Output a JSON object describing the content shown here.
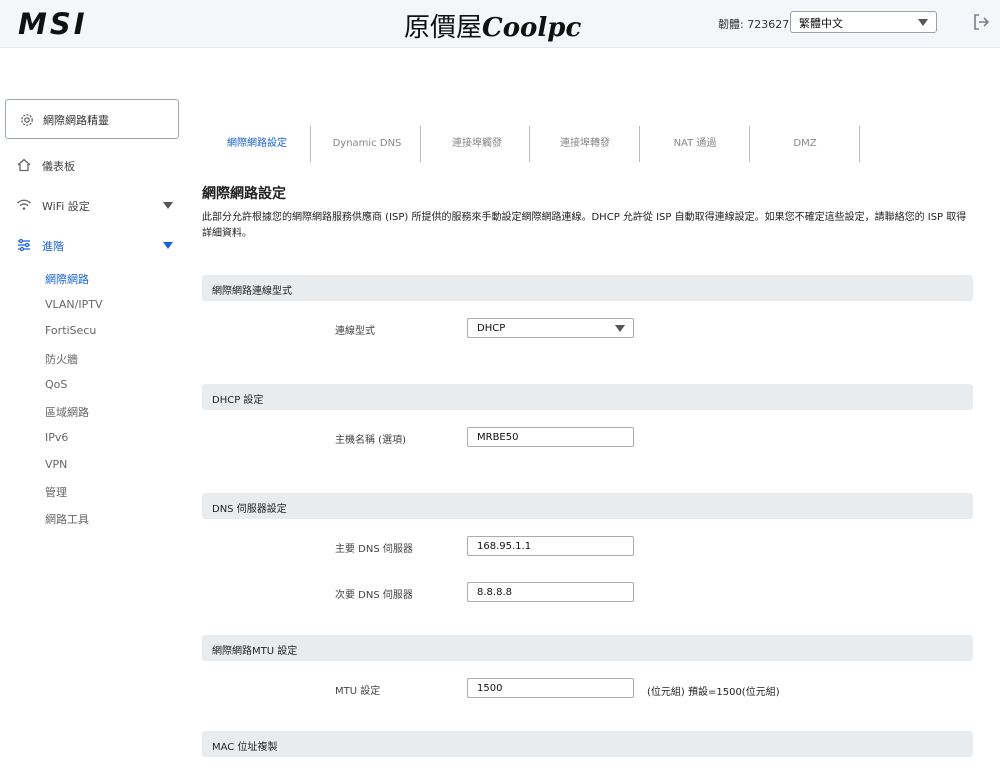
{
  "header": {
    "logo": "MSI",
    "brand_cjk": "原價屋",
    "brand_latin": "Coolpc",
    "firmware": "韌體: 723627",
    "language": "繁體中文"
  },
  "sidebar": {
    "wizard": "網際網路精靈",
    "items": [
      {
        "label": "儀表板",
        "icon": "dashboard-icon"
      },
      {
        "label": "WiFi 設定",
        "icon": "wifi-icon"
      },
      {
        "label": "進階",
        "icon": "sliders-icon"
      }
    ],
    "sub_items": [
      "網際網路",
      "VLAN/IPTV",
      "FortiSecu",
      "防火牆",
      "QoS",
      "區域網路",
      "IPv6",
      "VPN",
      "管理",
      "網路工具"
    ]
  },
  "tabs": [
    "網際網路設定",
    "Dynamic DNS",
    "連接埠觸發",
    "連接埠轉發",
    "NAT 通過",
    "DMZ"
  ],
  "main": {
    "title": "網際網路設定",
    "description": "此部分允許根據您的網際網路服務供應商 (ISP) 所提供的服務來手動設定網際網路連線。DHCP 允許從 ISP 自動取得連線設定。如果您不確定這些設定，請聯絡您的 ISP 取得詳細資料。",
    "sections": {
      "connection_type": {
        "header": "網際網路連線型式",
        "label": "連線型式",
        "value": "DHCP"
      },
      "dhcp": {
        "header": "DHCP 設定",
        "hostname_label": "主機名稱 (選項)",
        "hostname_value": "MRBE50"
      },
      "dns": {
        "header": "DNS 伺服器設定",
        "primary_label": "主要 DNS 伺服器",
        "primary_value": "168.95.1.1",
        "secondary_label": "次要 DNS 伺服器",
        "secondary_value": "8.8.8.8"
      },
      "mtu": {
        "header": "網際網路MTU 設定",
        "label": "MTU 設定",
        "value": "1500",
        "note": "(位元組)  預設=1500(位元組)"
      },
      "mac": {
        "header": "MAC 位址複製"
      }
    }
  },
  "colors": {
    "accent": "#1a63d9",
    "section_bg": "#e9ecef",
    "header_bg": "#f4f6f9"
  }
}
